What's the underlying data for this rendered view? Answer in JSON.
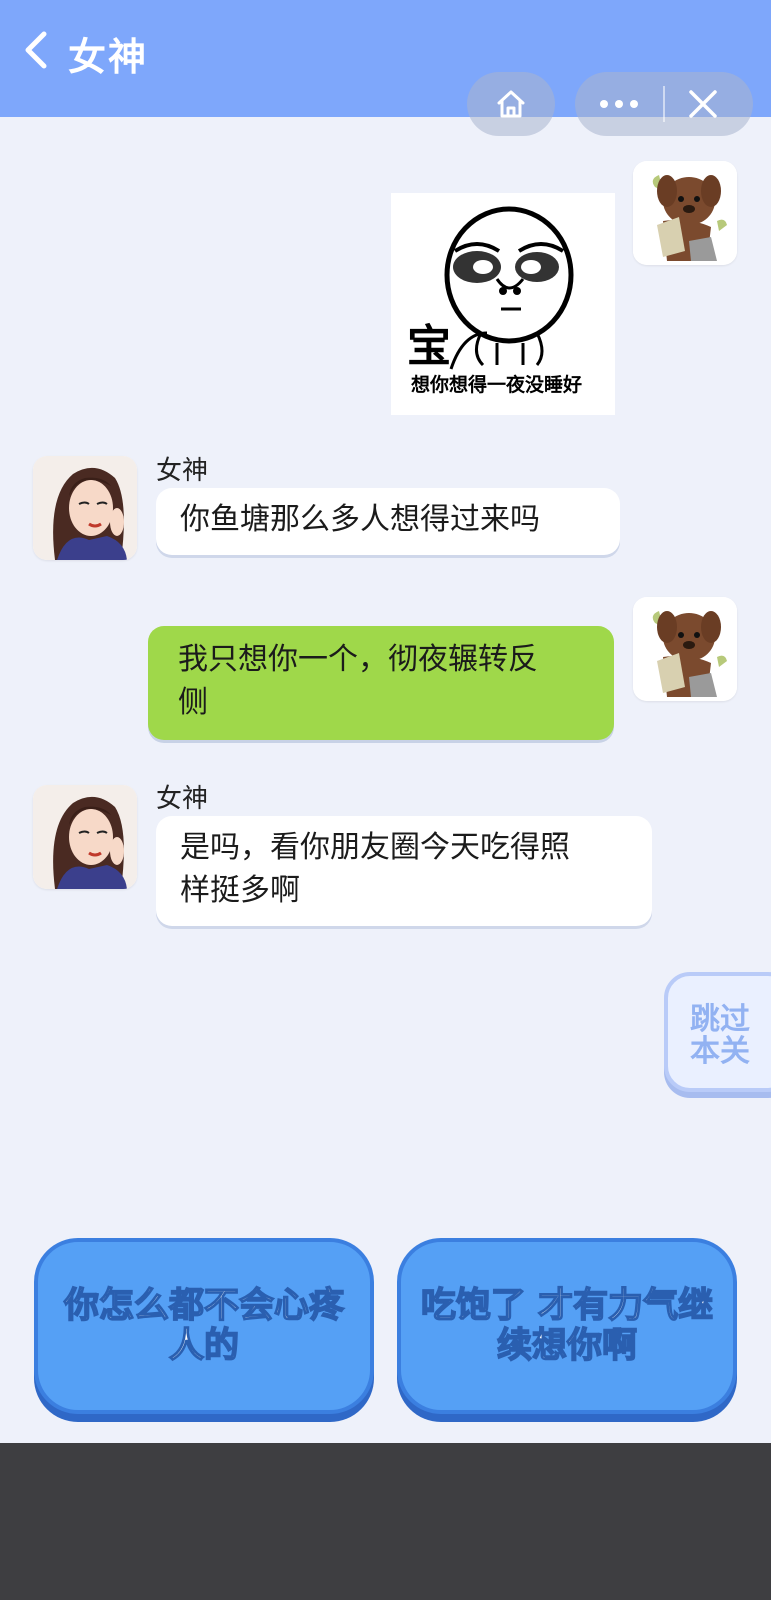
{
  "header": {
    "title": "女神",
    "bg_color": "#7ea7fb"
  },
  "capsule": {
    "home_icon": "home-icon",
    "more_icon": "more-dots-icon",
    "close_icon": "close-icon"
  },
  "messages": [
    {
      "side": "right",
      "type": "sticker",
      "sticker": {
        "big_char": "宝",
        "caption": "想你想得一夜没睡好"
      }
    },
    {
      "side": "left",
      "sender": "女神",
      "lines": [
        "你鱼塘那么多人想得过来吗"
      ]
    },
    {
      "side": "right",
      "lines": [
        "我只想你一个，彻夜辗转反",
        "侧"
      ]
    },
    {
      "side": "left",
      "sender": "女神",
      "lines": [
        "是吗，看你朋友圈今天吃得照",
        "样挺多啊"
      ]
    }
  ],
  "skip_button": {
    "lines": [
      "跳过",
      "本关"
    ]
  },
  "choices": [
    {
      "lines": [
        "你怎么都不会心疼",
        "人的"
      ]
    },
    {
      "lines": [
        "吃饱了 才有力气继",
        "续想你啊"
      ]
    }
  ],
  "colors": {
    "right_bubble": "#9fd84a",
    "choice": "#55a0f5",
    "page_bg": "#eef1fa"
  }
}
